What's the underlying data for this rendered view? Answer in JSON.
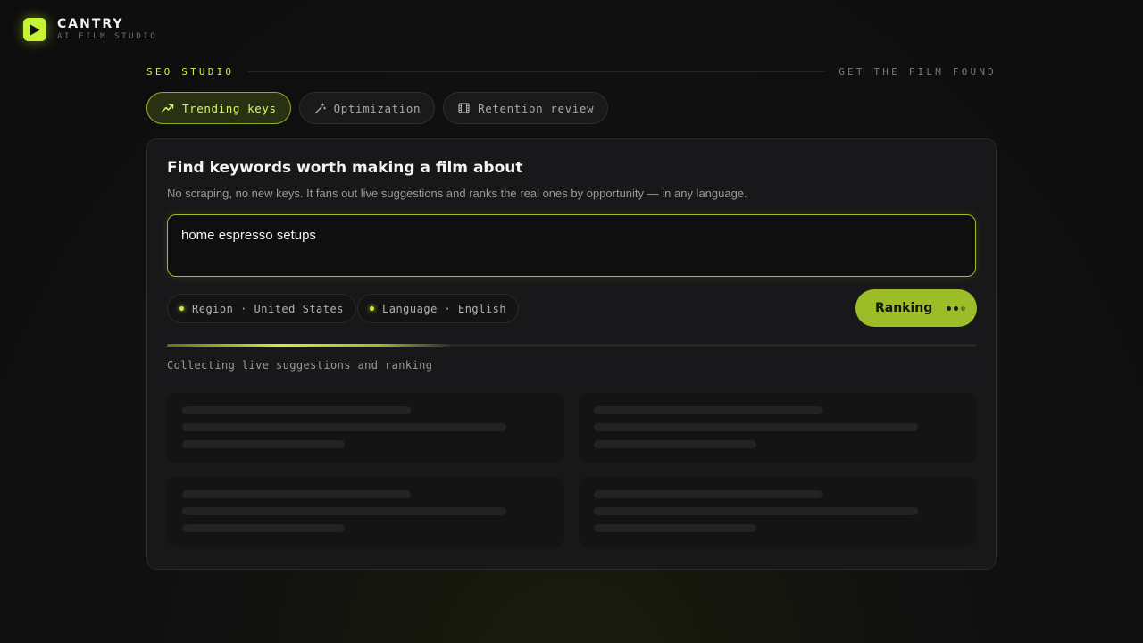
{
  "brand": {
    "name": "CANTRY",
    "tagline": "AI FILM STUDIO",
    "icon": "play-icon",
    "accent": "#c6f432"
  },
  "section": {
    "title": "SEO STUDIO",
    "tag": "GET THE FILM FOUND"
  },
  "tabs": [
    {
      "label": "Trending keys",
      "icon": "trending-up-icon",
      "active": true
    },
    {
      "label": "Optimization",
      "icon": "magic-wand-icon",
      "active": false
    },
    {
      "label": "Retention review",
      "icon": "film-icon",
      "active": false
    }
  ],
  "card": {
    "title": "Find keywords worth making a film about",
    "description": "No scraping, no new keys. It fans out live suggestions and ranks the real ones by opportunity — in any language.",
    "query": "home espresso setups",
    "chips": {
      "region": "Region · United States",
      "language": "Language · English"
    },
    "action_label": "Ranking",
    "progress": 0.35,
    "status": "Collecting live suggestions and ranking",
    "skeleton_count": 4
  },
  "colors": {
    "accent": "#c6f432",
    "accent_dim": "#9dbd28",
    "card_bg": "#18181a",
    "page_bg": "#111111"
  }
}
